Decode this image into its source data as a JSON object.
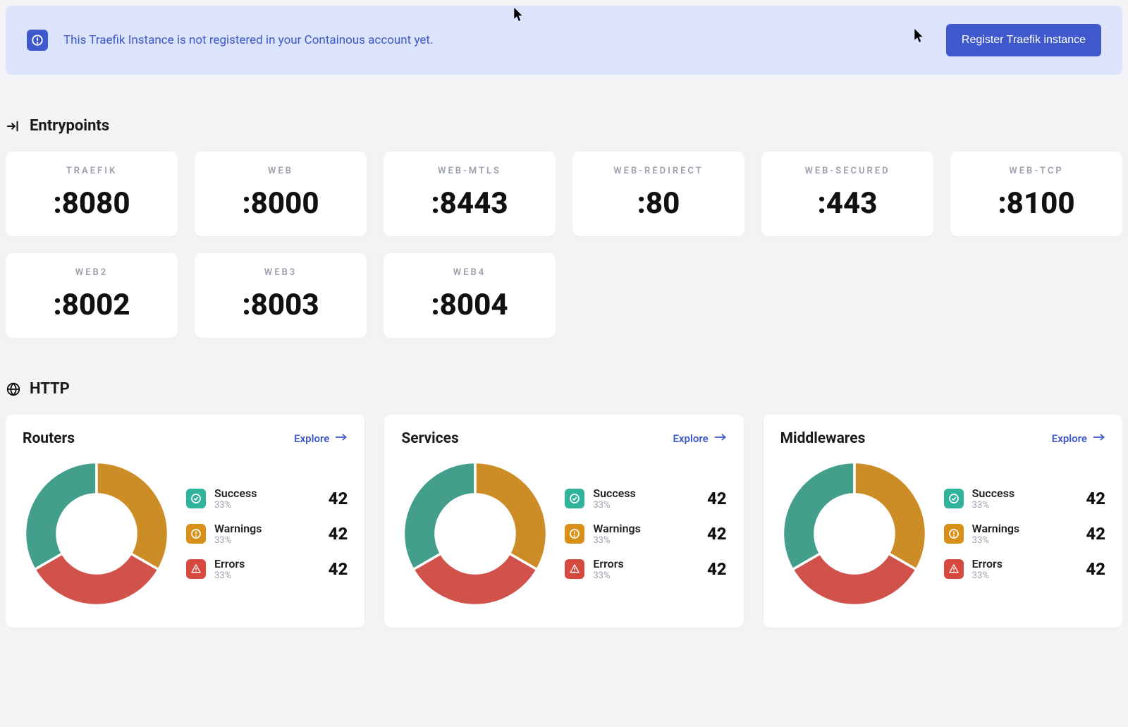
{
  "banner": {
    "message": "This Traefik Instance is not registered in your Containous account yet.",
    "button": "Register Traefik instance"
  },
  "sections": {
    "entrypoints_title": "Entrypoints",
    "http_title": "HTTP"
  },
  "entrypoints": [
    {
      "name": "TRAEFIK",
      "port": ":8080"
    },
    {
      "name": "WEB",
      "port": ":8000"
    },
    {
      "name": "WEB-MTLS",
      "port": ":8443"
    },
    {
      "name": "WEB-REDIRECT",
      "port": ":80"
    },
    {
      "name": "WEB-SECURED",
      "port": ":443"
    },
    {
      "name": "WEB-TCP",
      "port": ":8100"
    },
    {
      "name": "WEB2",
      "port": ":8002"
    },
    {
      "name": "WEB3",
      "port": ":8003"
    },
    {
      "name": "WEB4",
      "port": ":8004"
    }
  ],
  "explore_label": "Explore",
  "status_labels": {
    "success": "Success",
    "warnings": "Warnings",
    "errors": "Errors"
  },
  "panels": [
    {
      "title": "Routers",
      "success": {
        "pct": "33%",
        "count": "42"
      },
      "warnings": {
        "pct": "33%",
        "count": "42"
      },
      "errors": {
        "pct": "33%",
        "count": "42"
      }
    },
    {
      "title": "Services",
      "success": {
        "pct": "33%",
        "count": "42"
      },
      "warnings": {
        "pct": "33%",
        "count": "42"
      },
      "errors": {
        "pct": "33%",
        "count": "42"
      }
    },
    {
      "title": "Middlewares",
      "success": {
        "pct": "33%",
        "count": "42"
      },
      "warnings": {
        "pct": "33%",
        "count": "42"
      },
      "errors": {
        "pct": "33%",
        "count": "42"
      }
    }
  ],
  "colors": {
    "success": "#449e8c",
    "warning": "#cd8d26",
    "error": "#d1524b",
    "accent": "#3f58cc"
  },
  "chart_data": [
    {
      "type": "pie",
      "title": "Routers",
      "categories": [
        "Success",
        "Warnings",
        "Errors"
      ],
      "values": [
        33,
        33,
        33
      ]
    },
    {
      "type": "pie",
      "title": "Services",
      "categories": [
        "Success",
        "Warnings",
        "Errors"
      ],
      "values": [
        33,
        33,
        33
      ]
    },
    {
      "type": "pie",
      "title": "Middlewares",
      "categories": [
        "Success",
        "Warnings",
        "Errors"
      ],
      "values": [
        33,
        33,
        33
      ]
    }
  ]
}
